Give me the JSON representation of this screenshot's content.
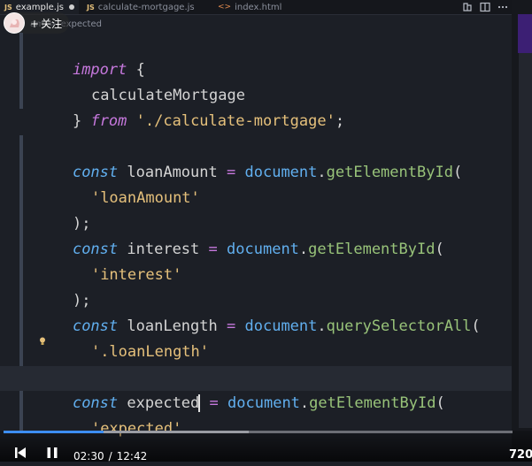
{
  "tabs": [
    {
      "icon": "JS",
      "label": "example.js",
      "modified": true
    },
    {
      "icon": "JS",
      "label": "calculate-mortgage.js"
    },
    {
      "icon": "<>",
      "label": "index.html"
    }
  ],
  "breadcrumb": {
    "prefix": "am",
    "separator": ">",
    "current": "expected"
  },
  "follow": {
    "plus": "+",
    "label": "关注"
  },
  "code": {
    "l1": {
      "kw": "import",
      "brace": "{"
    },
    "l2": {
      "id": "calculateMortgage"
    },
    "l3": {
      "brace": "}",
      "kw": "from",
      "path": "'./calculate-mortgage'",
      "semi": ";"
    },
    "l5": {
      "kw": "const",
      "var": "loanAmount",
      "eq": "=",
      "obj": "document",
      "dot": ".",
      "fn": "getElementById",
      "paren": "("
    },
    "l6": {
      "str": "'loanAmount'"
    },
    "l7": {
      "close": ");"
    },
    "l8": {
      "kw": "const",
      "var": "interest",
      "eq": "=",
      "obj": "document",
      "dot": ".",
      "fn": "getElementById",
      "paren": "("
    },
    "l9": {
      "str": "'interest'"
    },
    "l10": {
      "close": ");"
    },
    "l11": {
      "kw": "const",
      "var": "loanLength",
      "eq": "=",
      "obj": "document",
      "dot": ".",
      "fn": "querySelectorAll",
      "paren": "("
    },
    "l12": {
      "str": "'.loanLength'"
    },
    "l13": {
      "close": ");"
    },
    "l14": {
      "kw": "const",
      "var": "expected",
      "eq": "=",
      "obj": "document",
      "dot": ".",
      "fn": "getElementById",
      "paren": "("
    },
    "l15": {
      "str": "'expected'"
    },
    "l16": {
      "close": ");"
    }
  },
  "player": {
    "current_time": "02:30",
    "separator": "/",
    "duration": "12:42",
    "quality": "720",
    "progress_fraction": 0.197
  },
  "colors": {
    "progress": "#3d8ef3",
    "keyword": "#c678dd",
    "function": "#98c379",
    "string": "#e5c07b",
    "object": "#61afef"
  }
}
